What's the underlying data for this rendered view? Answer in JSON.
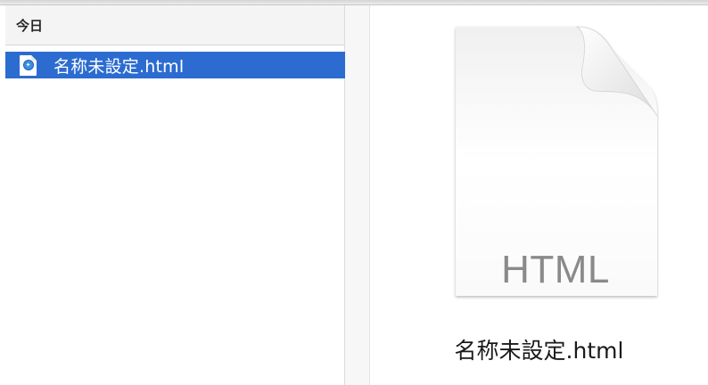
{
  "sidebar": {
    "group_header": "今日",
    "files": [
      {
        "name": "名称未設定.html",
        "icon": "safari-html-file-icon",
        "selected": true
      }
    ]
  },
  "preview": {
    "file_type": "HTML",
    "file_name": "名称未設定.html"
  },
  "colors": {
    "selection": "#2c6cd1",
    "header_bg": "#f4f4f4",
    "type_label": "#8a8a8a"
  }
}
